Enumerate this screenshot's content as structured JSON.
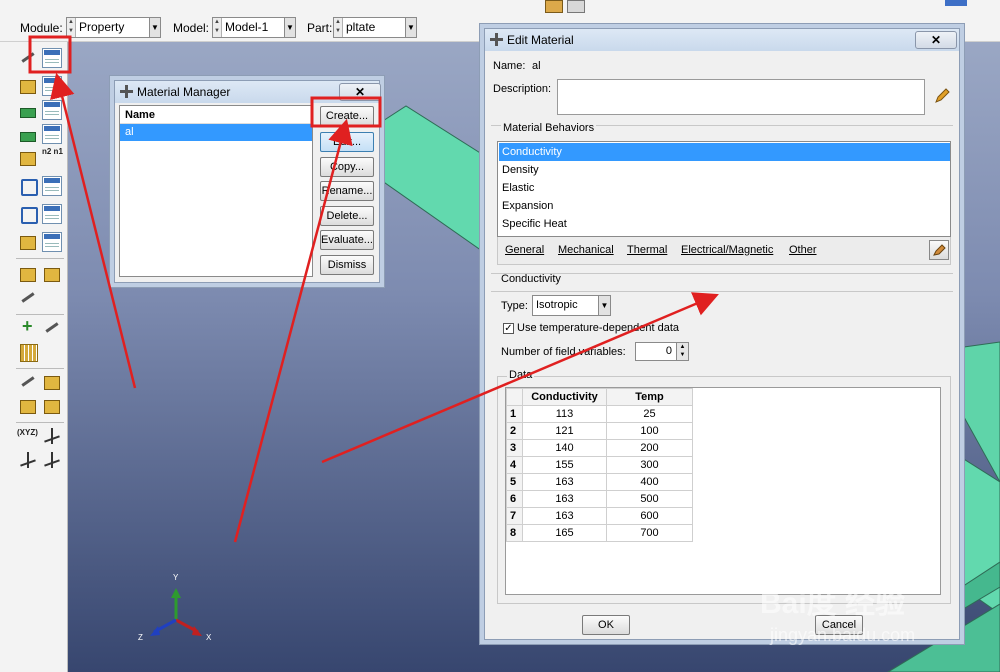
{
  "toolbar": {
    "module_label": "Module:",
    "module_value": "Property",
    "model_label": "Model:",
    "model_value": "Model-1",
    "part_label": "Part:",
    "part_value": "pltate"
  },
  "triad": {
    "y": "Y",
    "z": "Z",
    "x": "X"
  },
  "toolbox_text": {
    "xyz": "(XYZ)",
    "n2n1": "n2 n1"
  },
  "material_manager": {
    "title": "Material Manager",
    "close": "✕",
    "column": "Name",
    "items": [
      "al"
    ],
    "buttons": {
      "create": "Create...",
      "edit": "Edit...",
      "copy": "Copy...",
      "rename": "Rename...",
      "delete": "Delete...",
      "evaluate": "Evaluate...",
      "dismiss": "Dismiss"
    }
  },
  "edit_material": {
    "title": "Edit Material",
    "close": "✕",
    "name_label": "Name:",
    "name_value": "al",
    "description_label": "Description:",
    "description_value": "",
    "behaviors_label": "Material Behaviors",
    "behaviors": [
      "Conductivity",
      "Density",
      "Elastic",
      "Expansion",
      "Specific Heat"
    ],
    "menu": [
      "General",
      "Mechanical",
      "Thermal",
      "Electrical/Magnetic",
      "Other"
    ],
    "section_title": "Conductivity",
    "type_label": "Type:",
    "type_value": "Isotropic",
    "temp_dependent_label": "Use temperature-dependent data",
    "temp_dependent_checked": "✓",
    "field_vars_label": "Number of field variables:",
    "field_vars_value": "0",
    "data_label": "Data",
    "table_headers": [
      "Conductivity",
      "Temp"
    ],
    "rows": [
      {
        "n": "1",
        "conductivity": "113",
        "temp": "25"
      },
      {
        "n": "2",
        "conductivity": "121",
        "temp": "100"
      },
      {
        "n": "3",
        "conductivity": "140",
        "temp": "200"
      },
      {
        "n": "4",
        "conductivity": "155",
        "temp": "300"
      },
      {
        "n": "5",
        "conductivity": "163",
        "temp": "400"
      },
      {
        "n": "6",
        "conductivity": "163",
        "temp": "500"
      },
      {
        "n": "7",
        "conductivity": "163",
        "temp": "600"
      },
      {
        "n": "8",
        "conductivity": "165",
        "temp": "700"
      }
    ],
    "ok": "OK",
    "cancel": "Cancel"
  },
  "watermark": {
    "logo": "Bai度 经验",
    "url": "jingyan.baidu.com"
  },
  "colors": {
    "annotation": "#e02020",
    "plate_top": "#62d9ae",
    "selection": "#3399ff",
    "viewport_top": "#9aa7c4",
    "viewport_bottom": "#37466f"
  }
}
